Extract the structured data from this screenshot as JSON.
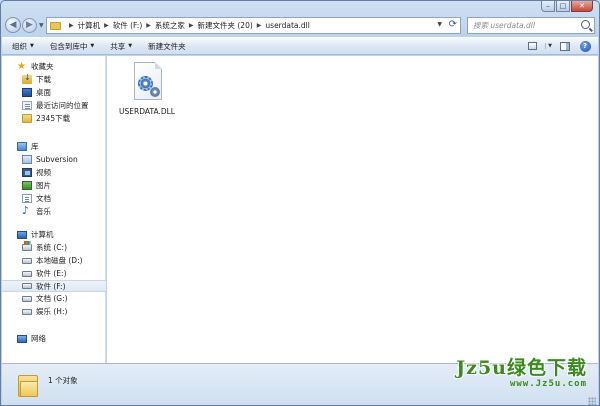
{
  "window": {
    "caption": {
      "minimize": "–",
      "maximize": "□",
      "close": "✕"
    }
  },
  "address": {
    "breadcrumbs": [
      "计算机",
      "软件 (F:)",
      "系统之家",
      "新建文件夹 (20)",
      "userdata.dll"
    ]
  },
  "search": {
    "placeholder": "搜索 userdata.dll"
  },
  "toolbar": {
    "organize": "组织",
    "include_in_library": "包含到库中",
    "share": "共享",
    "new_folder": "新建文件夹",
    "help": "?"
  },
  "sidebar": {
    "favorites": {
      "header": "收藏夹",
      "items": [
        "下载",
        "桌面",
        "最近访问的位置",
        "2345下载"
      ]
    },
    "libraries": {
      "header": "库",
      "items": [
        "Subversion",
        "视频",
        "图片",
        "文档",
        "音乐"
      ]
    },
    "computer": {
      "header": "计算机",
      "items": [
        "系统 (C:)",
        "本地磁盘 (D:)",
        "软件 (E:)",
        "软件 (F:)",
        "文档 (G:)",
        "娱乐 (H:)"
      ],
      "selected": "软件 (F:)"
    },
    "network": {
      "header": "网络"
    }
  },
  "content": {
    "files": [
      {
        "name": "USERDATA.DLL",
        "icon": "dll-file-icon"
      }
    ]
  },
  "status": {
    "text": "1 个对象"
  },
  "watermark": {
    "main": "Jz5u绿色下载",
    "sub": "www.Jz5u.com"
  },
  "colors": {
    "frame": "#bcd2eb",
    "selection": "#dfe8f3",
    "watermark": "#3b8a1e"
  }
}
